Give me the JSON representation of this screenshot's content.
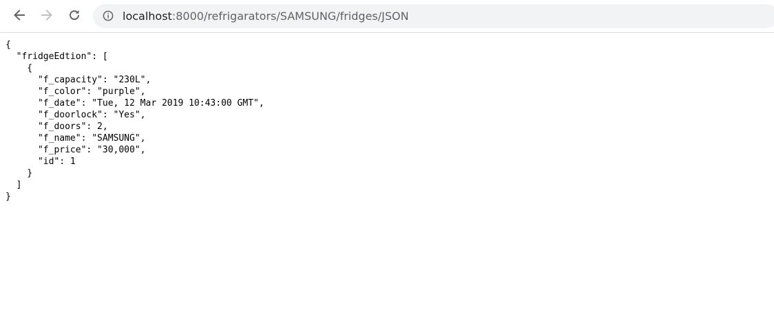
{
  "browser": {
    "address_bar": {
      "host": "localhost",
      "path": ":8000/refrigarators/SAMSUNG/fridges/JSON"
    },
    "icons": {
      "back": "back-arrow-icon",
      "forward": "forward-arrow-icon",
      "reload": "reload-icon",
      "site_info": "info-icon"
    },
    "colors": {
      "toolbar_icon": "#5f6368",
      "forward_disabled": "#bdc1c6",
      "omnibox_background": "#f1f3f4"
    }
  },
  "json_view": {
    "lines": [
      "{",
      "  \"fridgeEdtion\": [",
      "    {",
      "      \"f_capacity\": \"230L\",",
      "      \"f_color\": \"purple\",",
      "      \"f_date\": \"Tue, 12 Mar 2019 10:43:00 GMT\",",
      "      \"f_doorlock\": \"Yes\",",
      "      \"f_doors\": 2,",
      "      \"f_name\": \"SAMSUNG\",",
      "      \"f_price\": \"30,000\",",
      "      \"id\": 1",
      "    }",
      "  ]",
      "}"
    ]
  }
}
